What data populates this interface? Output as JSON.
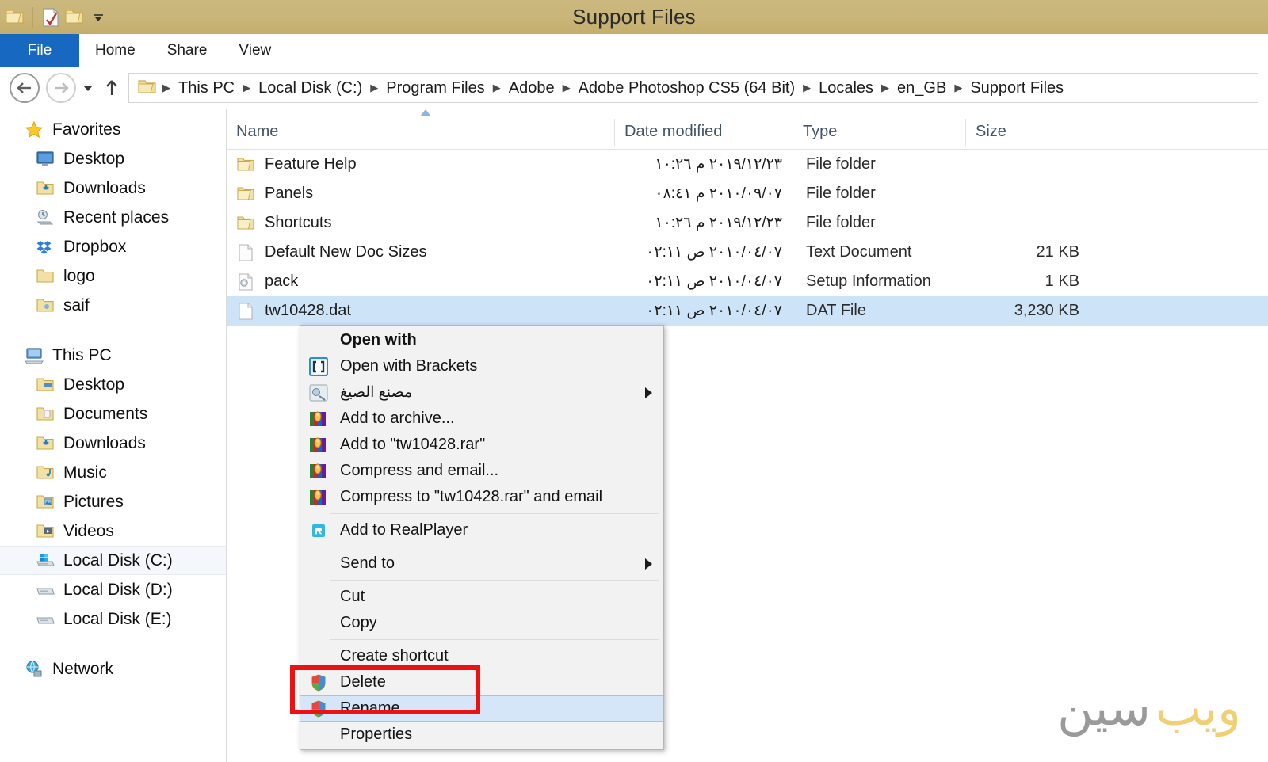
{
  "window": {
    "title": "Support Files",
    "titlebar_color": "#c9b578",
    "quick_access": [
      {
        "name": "folder-icon",
        "label": "Folder"
      },
      {
        "name": "properties-icon",
        "label": "Properties"
      },
      {
        "name": "new-folder-icon",
        "label": "New folder"
      },
      {
        "name": "chevron-down-icon",
        "label": "Customize Quick Access Toolbar"
      }
    ]
  },
  "ribbon": {
    "file_tab": "File",
    "tabs": [
      "Home",
      "Share",
      "View"
    ],
    "accent_color": "#1668c1"
  },
  "address_bar": {
    "back_label": "Back",
    "forward_label": "Forward",
    "recent_label": "Recent locations",
    "up_label": "Up one level",
    "crumbs": [
      "This PC",
      "Local Disk (C:)",
      "Program Files",
      "Adobe",
      "Adobe Photoshop CS5 (64 Bit)",
      "Locales",
      "en_GB",
      "Support Files"
    ]
  },
  "sidebar": {
    "groups": [
      {
        "header": {
          "label": "Favorites",
          "icon": "star-icon"
        },
        "items": [
          {
            "label": "Desktop",
            "icon": "desktop-icon"
          },
          {
            "label": "Downloads",
            "icon": "downloads-folder-icon"
          },
          {
            "label": "Recent places",
            "icon": "recent-places-icon"
          },
          {
            "label": "Dropbox",
            "icon": "dropbox-icon"
          },
          {
            "label": "logo",
            "icon": "folder-icon"
          },
          {
            "label": "saif",
            "icon": "folder-icon"
          }
        ]
      },
      {
        "header": {
          "label": "This PC",
          "icon": "computer-icon"
        },
        "items": [
          {
            "label": "Desktop",
            "icon": "desktop-folder-icon"
          },
          {
            "label": "Documents",
            "icon": "documents-folder-icon"
          },
          {
            "label": "Downloads",
            "icon": "downloads-folder-icon"
          },
          {
            "label": "Music",
            "icon": "music-folder-icon"
          },
          {
            "label": "Pictures",
            "icon": "pictures-folder-icon"
          },
          {
            "label": "Videos",
            "icon": "videos-folder-icon"
          },
          {
            "label": "Local Disk (C:)",
            "icon": "system-drive-icon",
            "selected": true
          },
          {
            "label": "Local Disk (D:)",
            "icon": "drive-icon"
          },
          {
            "label": "Local Disk (E:)",
            "icon": "drive-icon"
          }
        ]
      },
      {
        "header": {
          "label": "Network",
          "icon": "network-icon"
        },
        "items": []
      }
    ]
  },
  "file_list": {
    "columns": [
      "Name",
      "Date modified",
      "Type",
      "Size"
    ],
    "sort_column": "Name",
    "sort_direction": "ascending",
    "rows": [
      {
        "name": "Feature Help",
        "icon": "folder-icon",
        "date": "٢٠١٩/١٢/٢٣ م ١٠:٢٦",
        "type": "File folder",
        "size": ""
      },
      {
        "name": "Panels",
        "icon": "folder-icon",
        "date": "٢٠١٠/٠٩/٠٧ م ٠٨:٤١",
        "type": "File folder",
        "size": ""
      },
      {
        "name": "Shortcuts",
        "icon": "folder-icon",
        "date": "٢٠١٩/١٢/٢٣ م ١٠:٢٦",
        "type": "File folder",
        "size": ""
      },
      {
        "name": "Default New Doc Sizes",
        "icon": "text-file-icon",
        "date": "٢٠١٠/٠٤/٠٧ ص ٠٢:١١",
        "type": "Text Document",
        "size": "21 KB"
      },
      {
        "name": "pack",
        "icon": "setup-info-icon",
        "date": "٢٠١٠/٠٤/٠٧ ص ٠٢:١١",
        "type": "Setup Information",
        "size": "1 KB"
      },
      {
        "name": "tw10428.dat",
        "icon": "dat-file-icon",
        "date": "٢٠١٠/٠٤/٠٧ ص ٠٢:١١",
        "type": "DAT File",
        "size": "3,230 KB",
        "selected": true
      }
    ]
  },
  "context_menu": {
    "items": [
      {
        "label": "Open with",
        "icon": null,
        "bold": true
      },
      {
        "label": "Open with Brackets",
        "icon": "brackets-icon"
      },
      {
        "label": "مصنع الصيغ",
        "icon": "format-factory-icon",
        "rtl": true,
        "submenu": true
      },
      {
        "label": "Add to archive...",
        "icon": "winrar-icon"
      },
      {
        "label": "Add to \"tw10428.rar\"",
        "icon": "winrar-icon"
      },
      {
        "label": "Compress and email...",
        "icon": "winrar-icon"
      },
      {
        "label": "Compress to \"tw10428.rar\" and email",
        "icon": "winrar-icon"
      },
      {
        "separator_after": true,
        "label": "Add to RealPlayer",
        "icon": "realplayer-icon"
      },
      {
        "label": "Send to",
        "icon": null,
        "submenu": true,
        "separator_after": true
      },
      {
        "label": "Cut",
        "icon": null
      },
      {
        "label": "Copy",
        "icon": null,
        "separator_after": true
      },
      {
        "label": "Create shortcut",
        "icon": null
      },
      {
        "label": "Delete",
        "icon": "shield-icon"
      },
      {
        "label": "Rename",
        "icon": "shield-icon",
        "highlighted": true
      },
      {
        "label": "Properties",
        "icon": null
      }
    ]
  },
  "annotation": {
    "highlight_target": "Rename",
    "box_color": "#ee1111"
  },
  "watermark": {
    "text_gray": "سين",
    "text_yellow": "ويب",
    "gray_color": "#9a9a9a",
    "yellow_color": "#f2cf72"
  }
}
